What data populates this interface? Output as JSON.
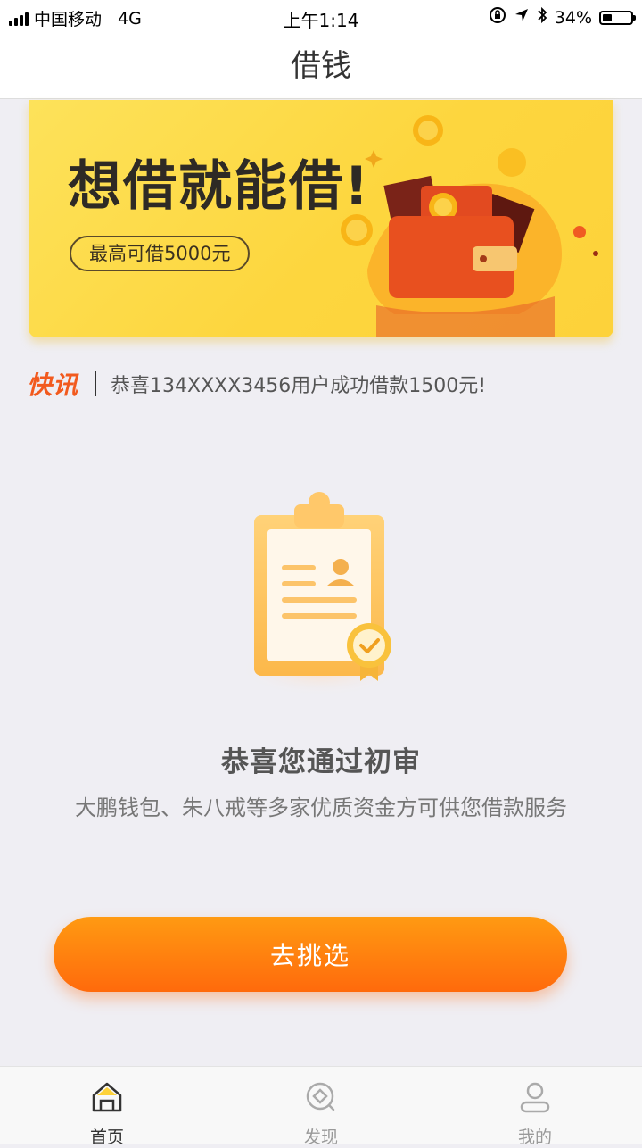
{
  "status_bar": {
    "carrier": "中国移动",
    "network": "4G",
    "time": "上午1:14",
    "battery": "34%"
  },
  "nav": {
    "title": "借钱"
  },
  "banner": {
    "headline": "想借就能借!",
    "pill": "最高可借5000元"
  },
  "news": {
    "brand": "快讯",
    "message": "恭喜134XXXX3456用户成功借款1500元!"
  },
  "result": {
    "title": "恭喜您通过初审",
    "subtitle": "大鹏钱包、朱八戒等多家优质资金方可供您借款服务"
  },
  "cta": {
    "label": "去挑选"
  },
  "tabs": [
    {
      "label": "首页",
      "icon": "home-icon",
      "active": true
    },
    {
      "label": "发现",
      "icon": "discover-icon",
      "active": false
    },
    {
      "label": "我的",
      "icon": "profile-icon",
      "active": false
    }
  ],
  "colors": {
    "accent": "#ff7a10",
    "banner": "#fdd63e",
    "brand_red": "#f25a1e"
  }
}
